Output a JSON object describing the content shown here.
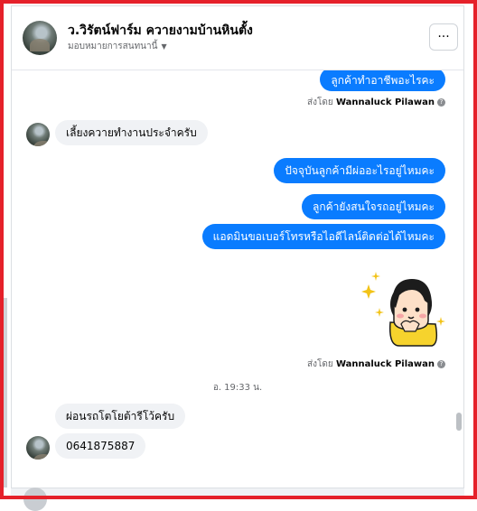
{
  "header": {
    "page_name": "ว.วิรัตน์ฟาร์ม ควายงามบ้านหินตั้ง",
    "assign_label": "มอบหมายการสนทนานี้",
    "more_label": "···"
  },
  "messages": [
    {
      "dir": "out",
      "text": "ลูกค้าทำอาชีพอะไรคะ"
    },
    {
      "sent_by_prefix": "ส่งโดย",
      "sent_by_name": "Wannaluck Pilawan"
    },
    {
      "dir": "in",
      "text": "เลี้ยงควายทำงานประจำครับ"
    },
    {
      "dir": "out",
      "text": "ปัจจุบันลูกค้ามีผ่ออะไรอยู่ไหมคะ"
    },
    {
      "dir": "out",
      "text": "ลูกค้ายังสนใจรถอยู่ไหมคะ"
    },
    {
      "dir": "out",
      "text": "แอดมินขอเบอร์โทรหรือไอดีไลน์ติดต่อได้ไหมคะ"
    },
    {
      "sent_by_prefix": "ส่งโดย",
      "sent_by_name": "Wannaluck Pilawan"
    },
    {
      "timestamp": "อ. 19:33 น."
    },
    {
      "dir": "in",
      "text": "ผ่อนรถโตโยต้ารีโว้ครับ"
    },
    {
      "dir": "in",
      "text": "0641875887"
    }
  ],
  "icons": {
    "info": "info-icon",
    "caret": "caret-down-icon",
    "sticker": "girl-sticker"
  },
  "colors": {
    "outgoing": "#0a7cff",
    "incoming": "#f0f2f5",
    "frame": "#e5212a"
  }
}
